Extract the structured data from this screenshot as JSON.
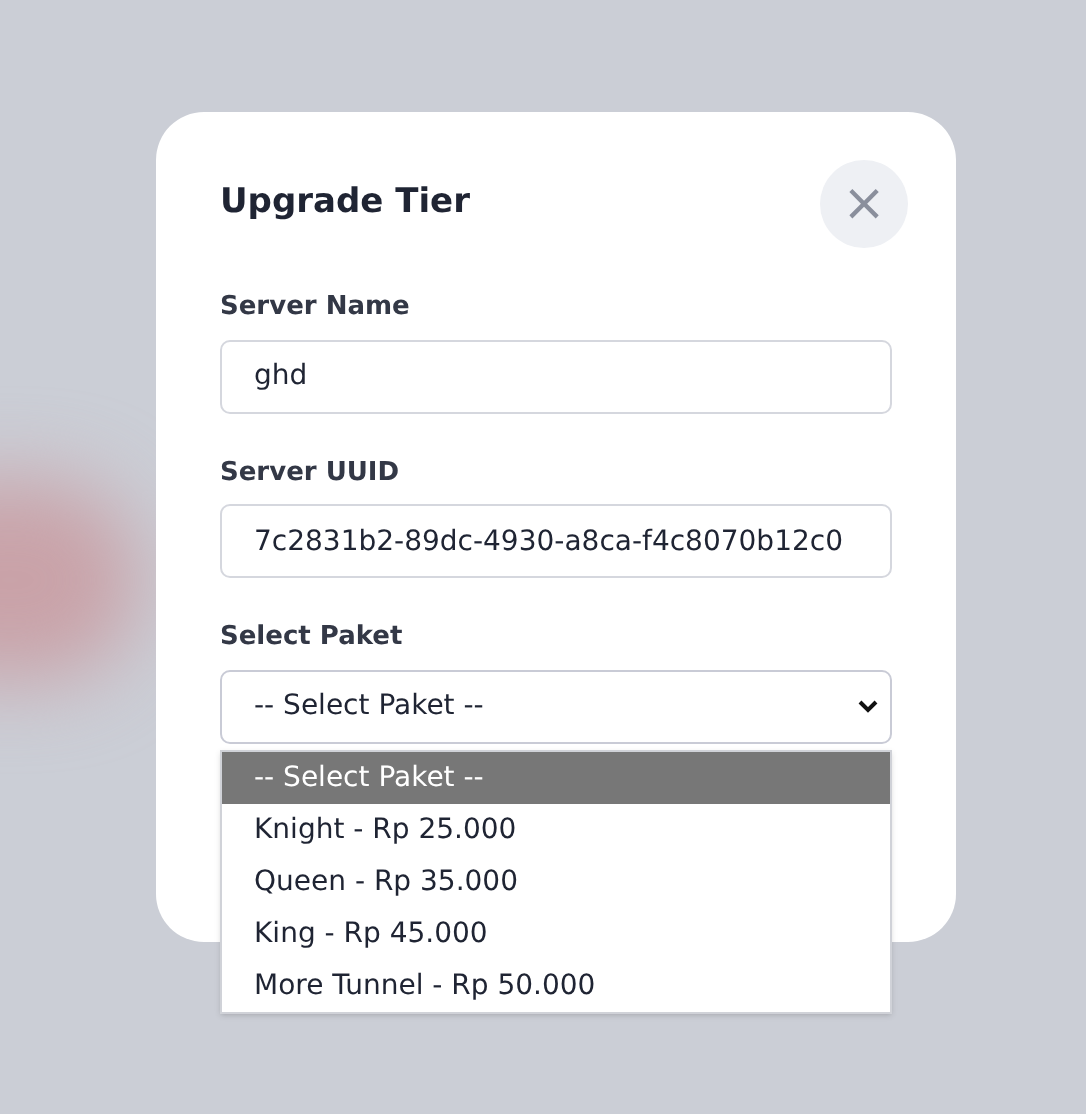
{
  "dialog": {
    "title": "Upgrade Tier",
    "close_icon": "×",
    "fields": [
      {
        "label": "Server Name",
        "value": "ghd"
      },
      {
        "label": "Server UUID",
        "value": "7c2831b2-89dc-4930-a8ca-f4c8070b12c0"
      }
    ],
    "select": {
      "label": "Select Paket",
      "value": "-- Select Paket --",
      "expanded": true,
      "options": [
        {
          "label": "-- Select Paket --",
          "selected": true
        },
        {
          "label": "Knight - Rp 25.000",
          "selected": false
        },
        {
          "label": "Queen - Rp 35.000",
          "selected": false
        },
        {
          "label": "King - Rp 45.000",
          "selected": false
        },
        {
          "label": "More Tunnel - Rp 50.000",
          "selected": false
        }
      ]
    }
  }
}
